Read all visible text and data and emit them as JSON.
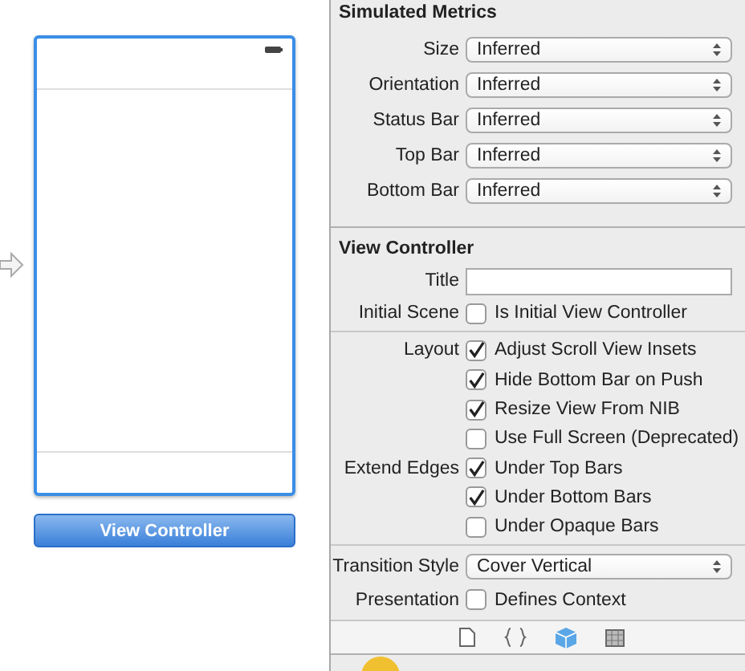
{
  "canvas": {
    "scene_button": "View Controller",
    "is_initial": true,
    "selected": true
  },
  "inspector": {
    "sections": [
      {
        "title": "Simulated Metrics",
        "groups": [
          [
            {
              "kind": "select",
              "label": "Size",
              "value": "Inferred"
            },
            {
              "kind": "select",
              "label": "Orientation",
              "value": "Inferred"
            },
            {
              "kind": "select",
              "label": "Status Bar",
              "value": "Inferred"
            },
            {
              "kind": "select",
              "label": "Top Bar",
              "value": "Inferred"
            },
            {
              "kind": "select",
              "label": "Bottom Bar",
              "value": "Inferred"
            }
          ]
        ]
      },
      {
        "title": "View Controller",
        "groups": [
          [
            {
              "kind": "text",
              "label": "Title"
            },
            {
              "kind": "checkbox",
              "label": "Initial Scene",
              "text": "Is Initial View Controller",
              "checked": false
            }
          ],
          [
            {
              "kind": "checkbox",
              "label": "Layout",
              "text": "Adjust Scroll View Insets",
              "checked": true
            },
            {
              "kind": "checkbox",
              "text": "Hide Bottom Bar on Push",
              "checked": true
            },
            {
              "kind": "checkbox",
              "text": "Resize View From NIB",
              "checked": true
            },
            {
              "kind": "checkbox",
              "text": "Use Full Screen (Deprecated)",
              "checked": false
            },
            {
              "kind": "checkbox",
              "label": "Extend Edges",
              "text": "Under Top Bars",
              "checked": true
            },
            {
              "kind": "checkbox",
              "text": "Under Bottom Bars",
              "checked": true
            },
            {
              "kind": "checkbox",
              "text": "Under Opaque Bars",
              "checked": false
            }
          ],
          [
            {
              "kind": "select",
              "label": "Transition Style",
              "value": "Cover Vertical"
            },
            {
              "kind": "checkbox",
              "label": "Presentation",
              "text": "Defines Context",
              "checked": false
            }
          ]
        ]
      }
    ]
  },
  "library_tabs": [
    {
      "kind": "file",
      "selected": false
    },
    {
      "kind": "braces",
      "selected": false
    },
    {
      "kind": "cube",
      "selected": true
    },
    {
      "kind": "grid",
      "selected": false
    }
  ]
}
